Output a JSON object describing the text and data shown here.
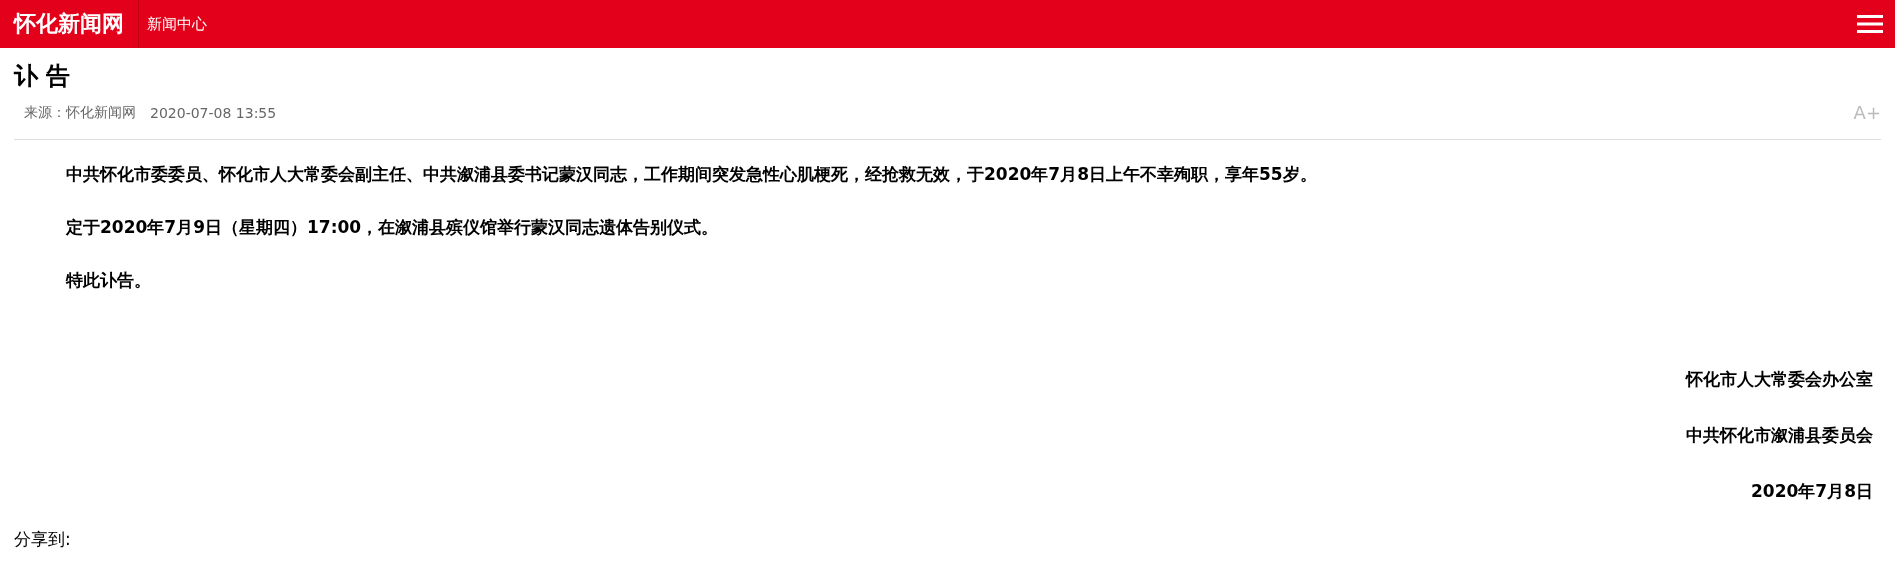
{
  "header": {
    "logo": "怀化新闻网",
    "section": "新闻中心"
  },
  "article": {
    "title": "讣 告",
    "source": "来源：怀化新闻网",
    "date": "2020-07-08 13:55",
    "font_button": "A+",
    "paragraphs": [
      "中共怀化市委委员、怀化市人大常委会副主任、中共溆浦县委书记蒙汉同志，工作期间突发急性心肌梗死，经抢救无效，于2020年7月8日上午不幸殉职，享年55岁。",
      "定于2020年7月9日（星期四）17:00，在溆浦县殡仪馆举行蒙汉同志遗体告别仪式。",
      "特此讣告。"
    ],
    "signatures": [
      "怀化市人大常委会办公室",
      "中共怀化市溆浦县委员会",
      "2020年7月8日"
    ]
  },
  "share": {
    "label": "分享到:"
  }
}
